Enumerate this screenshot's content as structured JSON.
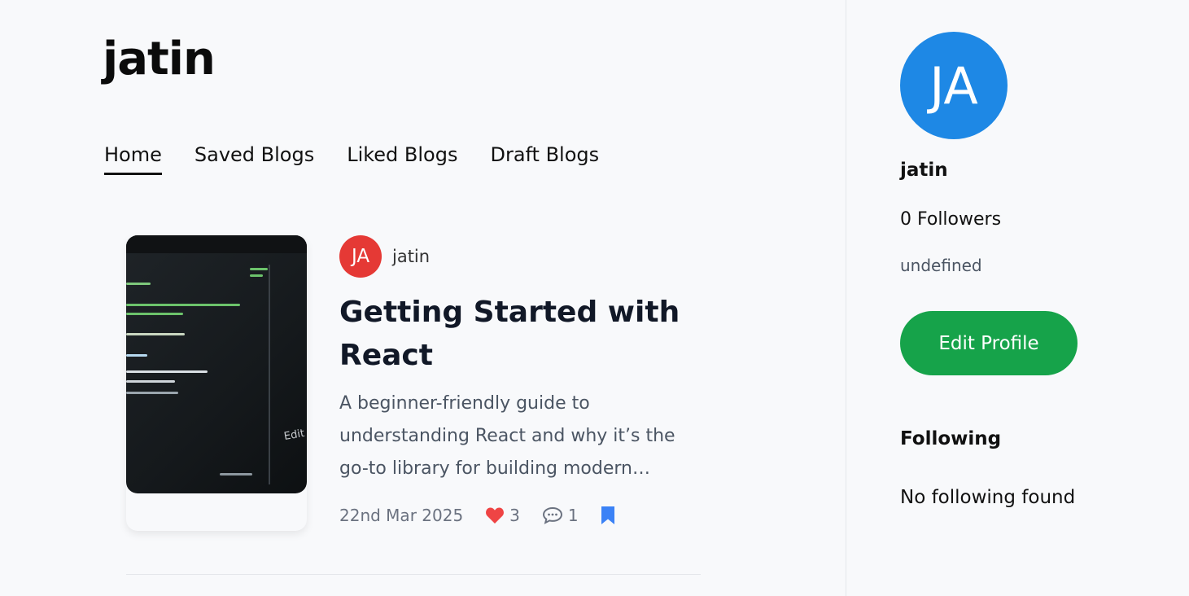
{
  "page": {
    "title": "jatin"
  },
  "tabs": [
    {
      "label": "Home",
      "active": true
    },
    {
      "label": "Saved Blogs",
      "active": false
    },
    {
      "label": "Liked Blogs",
      "active": false
    },
    {
      "label": "Draft Blogs",
      "active": false
    }
  ],
  "post": {
    "author_initials": "JA",
    "author_name": "jatin",
    "title": "Getting Started with React",
    "excerpt": "A beginner-friendly guide to understanding React and why it’s the go-to library for building modern…",
    "date": "22nd Mar 2025",
    "likes": "3",
    "comments": "1",
    "thumbnail_text": "Edit",
    "icons": {
      "like": "heart-icon",
      "comment": "comment-icon",
      "save": "bookmark-icon"
    },
    "colors": {
      "avatar": "#e53935",
      "like": "#ef4444",
      "bookmark": "#3b82f6"
    }
  },
  "profile": {
    "initials": "JA",
    "name": "jatin",
    "followers": "0 Followers",
    "bio": "undefined",
    "edit_label": "Edit Profile",
    "following_heading": "Following",
    "following_empty": "No following found",
    "colors": {
      "avatar": "#1e88e5",
      "edit_button": "#16a34a"
    }
  }
}
